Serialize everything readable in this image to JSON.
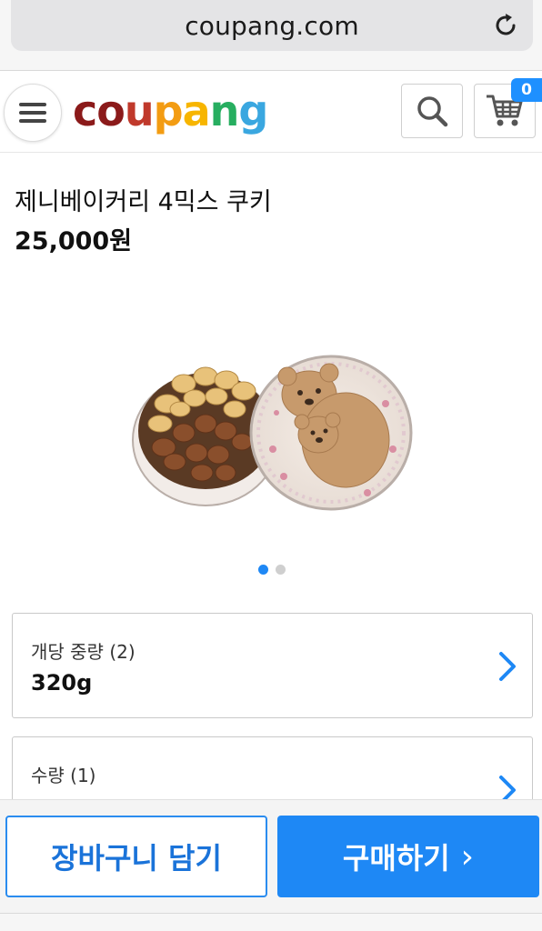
{
  "browser": {
    "url": "coupang.com",
    "reload_icon": "reload-icon"
  },
  "header": {
    "menu_icon": "hamburger-menu-icon",
    "logo_letters": [
      "c",
      "o",
      "u",
      "p",
      "a",
      "n",
      "g"
    ],
    "logo_colors": [
      "#8b1a1a",
      "#8b1a1a",
      "#c0392b",
      "#f39c12",
      "#f7b500",
      "#27ae60",
      "#3aa7e0"
    ],
    "search_icon": "search-icon",
    "cart_icon": "cart-icon",
    "cart_count": "0"
  },
  "product": {
    "title": "제니베이커리 4믹스 쿠키",
    "price": "25,000원",
    "image_icon": "cookie-tin-image",
    "carousel_active": 1,
    "carousel_total": 2
  },
  "options": [
    {
      "label": "개당 중량 (2)",
      "value": "320g"
    },
    {
      "label": "수량 (1)",
      "value": ""
    }
  ],
  "actions": {
    "add_to_cart": "장바구니 담기",
    "buy_now": "구매하기",
    "buy_chevron": "›"
  },
  "colors": {
    "accent": "#1e88f5",
    "badge": "#1e90ff",
    "dot_active": "#1e88f5",
    "dot_inactive": "#cfcfcf"
  }
}
